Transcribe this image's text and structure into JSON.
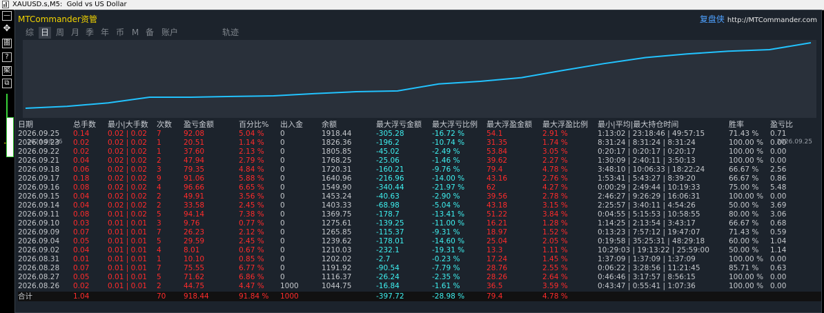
{
  "titlebar": {
    "text": "XAUUSD.s,M5:  Gold vs US Dollar"
  },
  "leftbar": {
    "buttons": [
      "—",
      "✥",
      "圕",
      "?",
      "棸",
      "⧉"
    ]
  },
  "panel": {
    "brand": "MTCommander资管",
    "replay_label": "复盘侠",
    "replay_url": "http://MTCommander.com",
    "tabs": [
      {
        "label": "综",
        "active": false
      },
      {
        "label": "日",
        "active": true
      },
      {
        "label": "周",
        "active": false
      },
      {
        "label": "月",
        "active": false
      },
      {
        "label": "季",
        "active": false
      },
      {
        "label": "年",
        "active": false
      },
      {
        "label": "币",
        "active": false
      },
      {
        "label": "M",
        "active": false
      },
      {
        "label": "备",
        "active": false
      },
      {
        "label": "账户",
        "active": false
      },
      {
        "label": "轨迹",
        "active": false
      }
    ]
  },
  "chart_data": {
    "type": "line",
    "x_start_label": "2026.08.26",
    "x_end_label": "2026.09.25",
    "series": [
      {
        "values": [
          1044.75,
          1070,
          1116.37,
          1191.92,
          1191.92,
          1202.02,
          1210.03,
          1239.62,
          1265.85,
          1275.61,
          1369.75,
          1403.33,
          1453.24,
          1549.9,
          1640.96,
          1720.31,
          1768.25,
          1805.85,
          1826.36,
          1918.44
        ]
      }
    ],
    "line_color": "#22c3ff",
    "ylim": [
      1044.75,
      1918.44
    ]
  },
  "table": {
    "headers": [
      "日期",
      "总手数",
      "最小|大手数",
      "次数",
      "盈亏金额",
      "百分比%",
      "出入金",
      "余额",
      "最大浮亏金额",
      "最大浮亏比例",
      "最大浮盈金额",
      "最大浮盈比例",
      "最小|平均|最大持仓时间",
      "胜率",
      "盈亏比"
    ],
    "rows": [
      [
        "2026.09.25",
        "0.14",
        "0.02 | 0.02",
        "7",
        "92.08",
        "5.04 %",
        "0",
        "1918.44",
        "-305.28",
        "-16.72 %",
        "54.1",
        "2.91 %",
        "1:13:02 | 23:18:46 | 49:57:15",
        "71.43 %",
        "0.71"
      ],
      [
        "2026.09.23",
        "0.02",
        "0.02 | 0.02",
        "1",
        "20.51",
        "1.14 %",
        "0",
        "1826.36",
        "-196.2",
        "-10.74 %",
        "31.35",
        "1.74 %",
        "8:31:24 | 8:31:24 | 8:31:24",
        "100.00 %",
        "0.00"
      ],
      [
        "2026.09.22",
        "0.02",
        "0.02 | 0.02",
        "1",
        "37.60",
        "2.13 %",
        "0",
        "1805.85",
        "-45.02",
        "-2.49 %",
        "53.84",
        "3.05 %",
        "0:20:17 | 0:20:17 | 0:20:17",
        "100.00 %",
        "0.00"
      ],
      [
        "2026.09.21",
        "0.04",
        "0.02 | 0.02",
        "2",
        "47.94",
        "2.79 %",
        "0",
        "1768.25",
        "-25.06",
        "-1.46 %",
        "39.62",
        "2.27 %",
        "1:30:09 | 2:40:11 | 3:50:13",
        "100.00 %",
        "0.00"
      ],
      [
        "2026.09.18",
        "0.06",
        "0.02 | 0.02",
        "3",
        "79.35",
        "4.84 %",
        "0",
        "1720.31",
        "-160.21",
        "-9.76 %",
        "79.4",
        "4.78 %",
        "3:48:10 | 10:06:33 | 18:22:24",
        "66.67 %",
        "2.56"
      ],
      [
        "2026.09.17",
        "0.18",
        "0.02 | 0.02",
        "9",
        "91.06",
        "5.88 %",
        "0",
        "1640.96",
        "-216.96",
        "-14.00 %",
        "43.16",
        "2.76 %",
        "1:53:41 | 5:43:27 | 8:39:20",
        "66.67 %",
        "0.86"
      ],
      [
        "2026.09.16",
        "0.08",
        "0.02 | 0.02",
        "4",
        "96.66",
        "6.65 %",
        "0",
        "1549.90",
        "-340.44",
        "-21.97 %",
        "62",
        "4.27 %",
        "0:00:29 | 2:49:44 | 10:19:33",
        "75.00 %",
        "5.48"
      ],
      [
        "2026.09.15",
        "0.04",
        "0.02 | 0.02",
        "2",
        "49.91",
        "3.56 %",
        "0",
        "1453.24",
        "-40.63",
        "-2.90 %",
        "39.56",
        "2.78 %",
        "2:46:27 | 9:26:29 | 16:06:31",
        "100.00 %",
        "0.00"
      ],
      [
        "2026.09.14",
        "0.04",
        "0.02 | 0.02",
        "2",
        "33.58",
        "2.45 %",
        "0",
        "1403.33",
        "-68.98",
        "-5.04 %",
        "43.18",
        "3.15 %",
        "2:25:57 | 3:40:11 | 4:54:26",
        "50.00 %",
        "3.69"
      ],
      [
        "2026.09.11",
        "0.08",
        "0.01 | 0.02",
        "5",
        "94.14",
        "7.38 %",
        "0",
        "1369.75",
        "-178.7",
        "-13.41 %",
        "51.22",
        "3.84 %",
        "0:04:55 | 5:15:53 | 10:58:55",
        "80.00 %",
        "3.06"
      ],
      [
        "2026.09.10",
        "0.03",
        "0.01 | 0.01",
        "3",
        "9.76",
        "0.77 %",
        "0",
        "1275.61",
        "-139.25",
        "-11.00 %",
        "16.21",
        "1.28 %",
        "1:14:25 | 2:13:54 | 3:43:17",
        "66.67 %",
        "0.68"
      ],
      [
        "2026.09.09",
        "0.07",
        "0.01 | 0.01",
        "7",
        "26.23",
        "2.12 %",
        "0",
        "1265.85",
        "-115.37",
        "-9.31 %",
        "18.97",
        "1.52 %",
        "0:13:23 | 7:57:12 | 19:47:07",
        "71.43 %",
        "0.59"
      ],
      [
        "2026.09.04",
        "0.05",
        "0.01 | 0.01",
        "5",
        "29.59",
        "2.45 %",
        "0",
        "1239.62",
        "-178.01",
        "-14.60 %",
        "25.04",
        "2.05 %",
        "0:19:58 | 35:25:31 | 48:29:18",
        "60.00 %",
        "1.04"
      ],
      [
        "2026.09.02",
        "0.04",
        "0.01 | 0.01",
        "4",
        "8.01",
        "0.67 %",
        "0",
        "1210.03",
        "-232.1",
        "-19.31 %",
        "13.3",
        "1.11 %",
        "10:29:03 | 19:13:22 | 25:59:00",
        "50.00 %",
        "1.14"
      ],
      [
        "2026.08.31",
        "0.01",
        "0.01 | 0.01",
        "1",
        "10.10",
        "0.85 %",
        "0",
        "1202.02",
        "-2.7",
        "-0.23 %",
        "17.24",
        "1.45 %",
        "1:37:09 | 1:37:09 | 1:37:09",
        "100.00 %",
        "0.00"
      ],
      [
        "2026.08.28",
        "0.07",
        "0.01 | 0.01",
        "7",
        "75.55",
        "6.77 %",
        "0",
        "1191.92",
        "-90.54",
        "-7.79 %",
        "28.76",
        "2.55 %",
        "0:06:22 | 3:28:56 | 11:21:45",
        "85.71 %",
        "0.63"
      ],
      [
        "2026.08.27",
        "0.05",
        "0.01 | 0.01",
        "5",
        "71.62",
        "6.86 %",
        "0",
        "1116.37",
        "-26.24",
        "-2.35 %",
        "28.26",
        "2.64 %",
        "0:46:46 | 3:17:57 | 8:56:15",
        "100.00 %",
        "0.00"
      ],
      [
        "2026.08.26",
        "0.02",
        "0.01 | 0.01",
        "2",
        "44.75",
        "4.47 %",
        "1000",
        "1044.75",
        "-16.84",
        "-1.61 %",
        "36.5",
        "3.59 %",
        "0:43:47 | 0:55:41 | 1:07:36",
        "100.00 %",
        "0.00"
      ]
    ],
    "total": [
      "合计",
      "1.04",
      "",
      "70",
      "918.44",
      "91.84 %",
      "1000",
      "",
      "-397.72",
      "-28.98 %",
      "79.4",
      "4.78 %",
      "",
      "",
      ""
    ]
  },
  "colors": {
    "gray": "#c5c8cc",
    "red": "#ff2b2b",
    "cyan": "#3ef0f0",
    "white": "#e4e6e8",
    "panel_bg": "#1c232c",
    "chart_bg": "#29303a",
    "brand": "#f2d400",
    "accent": "#4ea1ff"
  }
}
